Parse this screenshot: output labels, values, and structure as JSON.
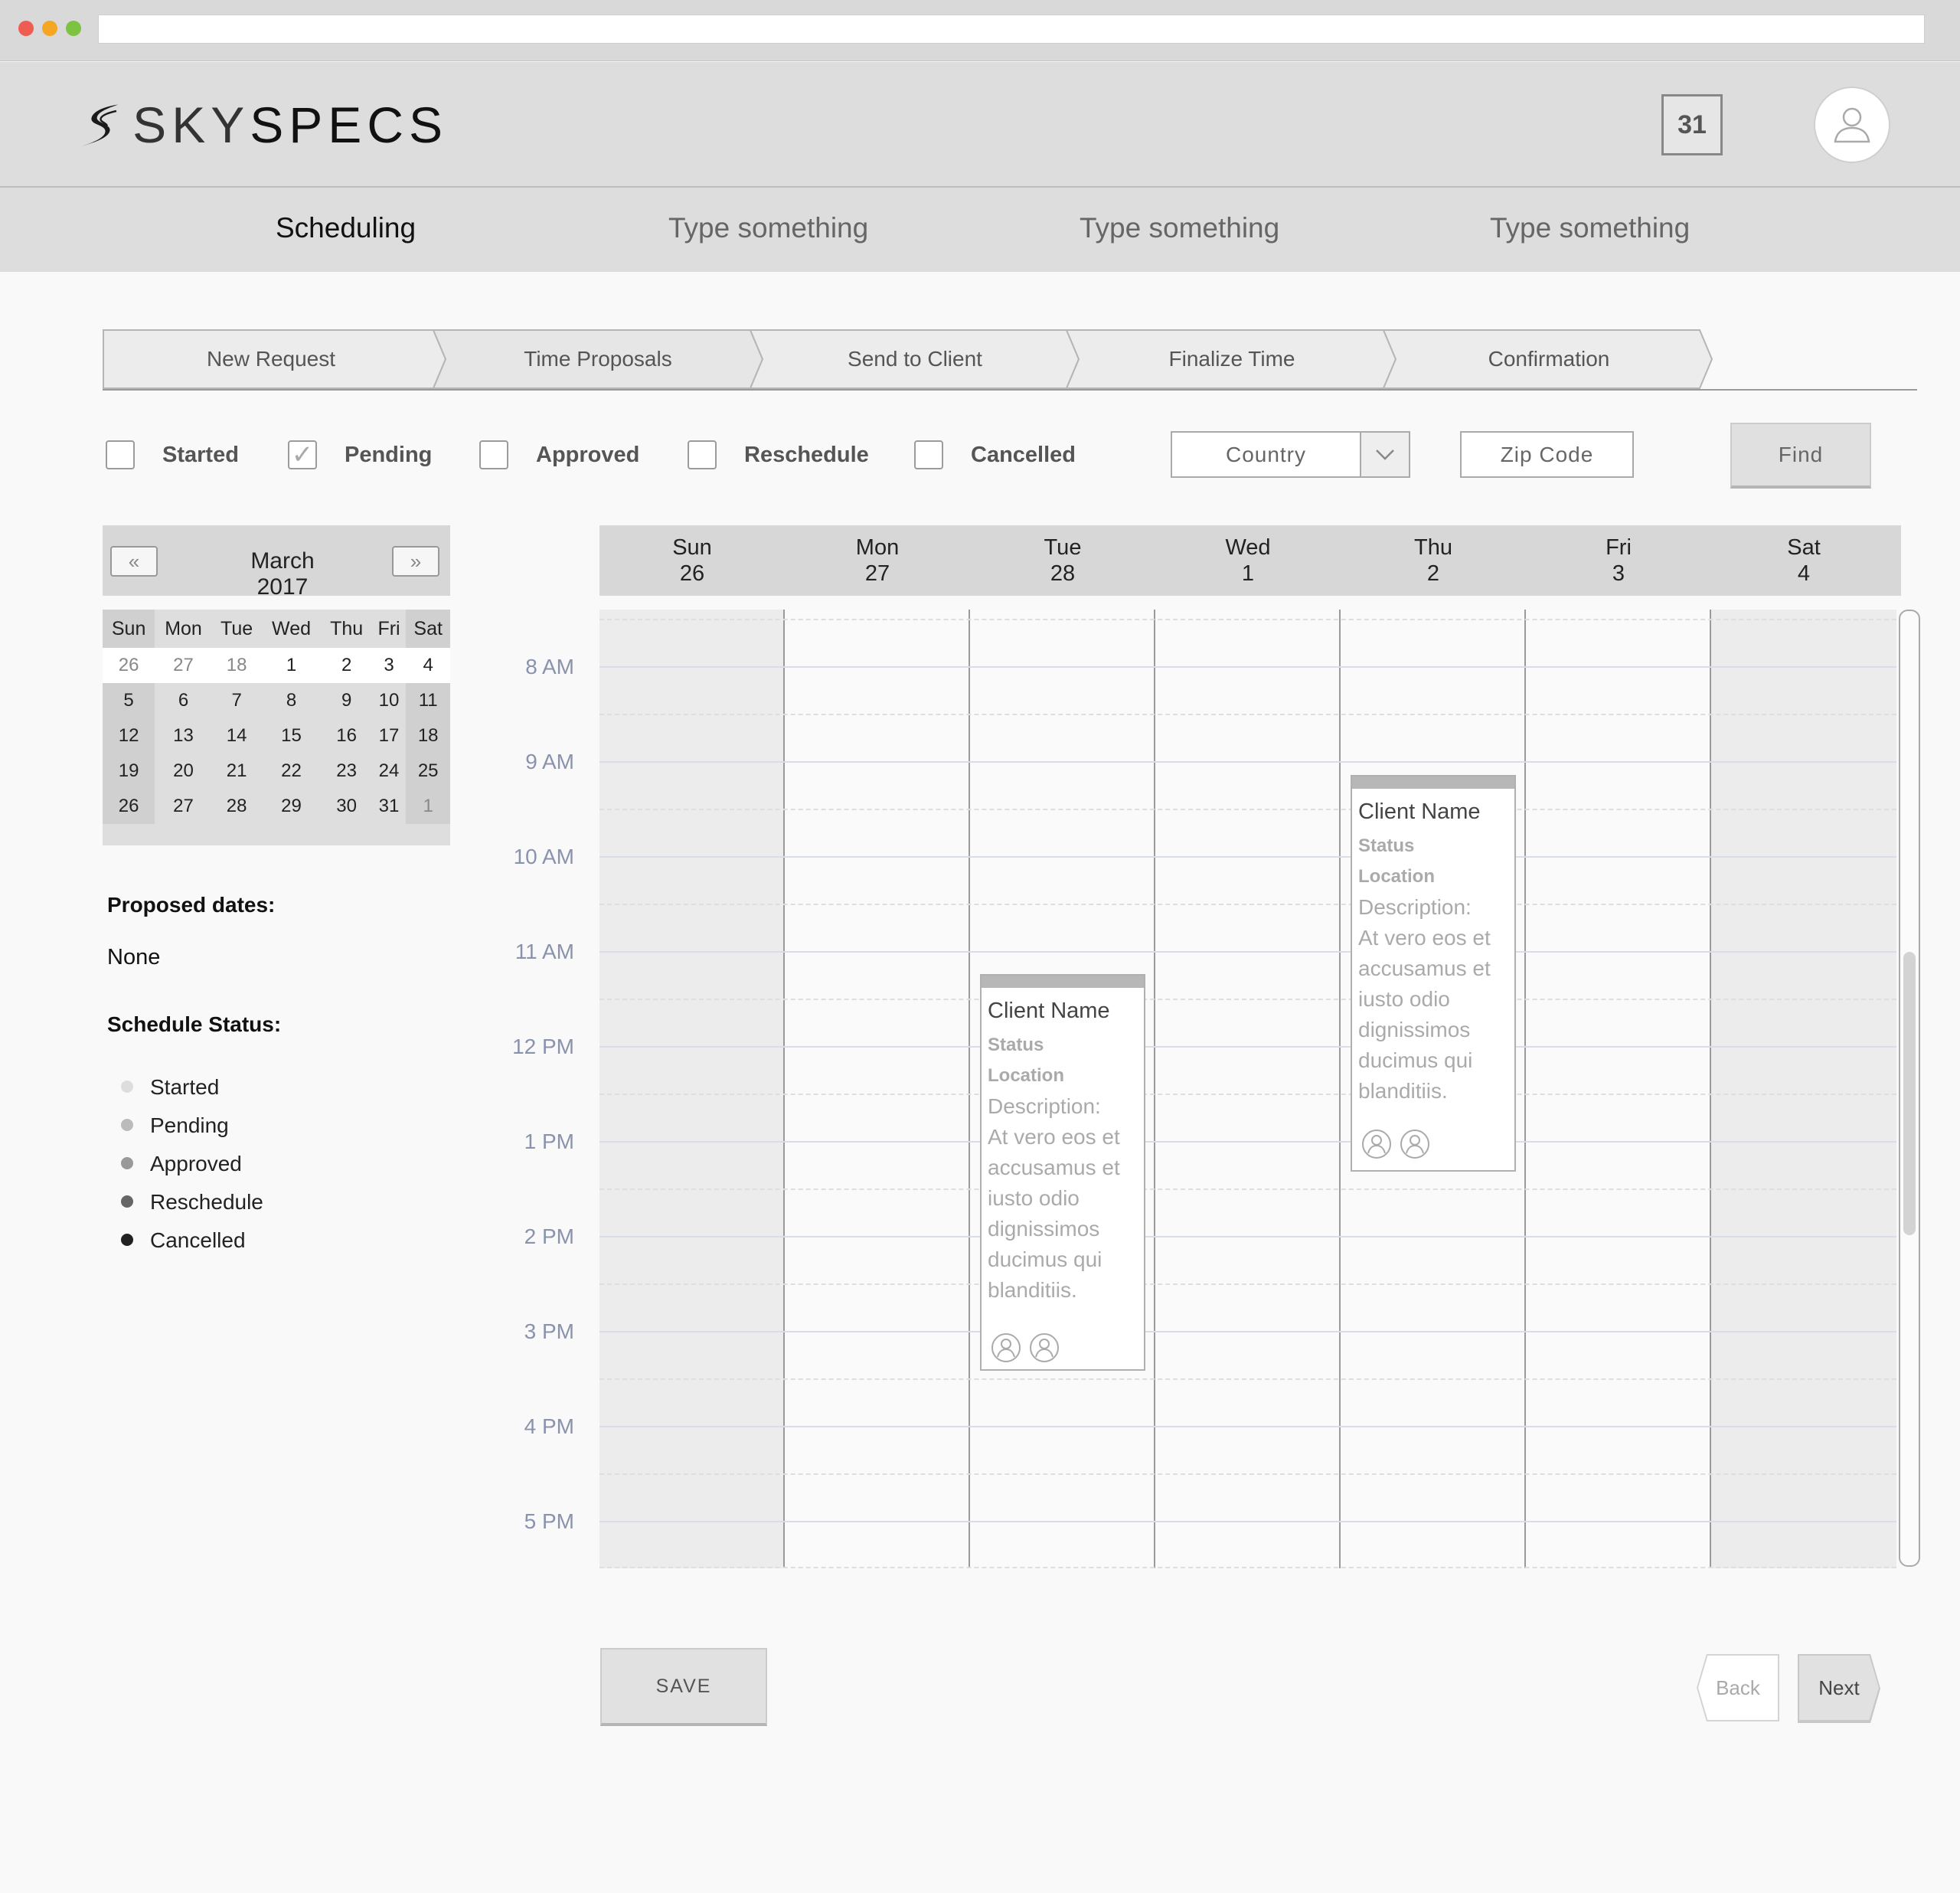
{
  "brand": {
    "name_light": "SKY",
    "name_bold": "SPECS"
  },
  "header": {
    "calendar_day": "31"
  },
  "nav": {
    "tabs": [
      "Scheduling",
      "Type something",
      "Type something",
      "Type something"
    ]
  },
  "steps": [
    "New Request",
    "Time Proposals",
    "Send to Client",
    "Finalize Time",
    "Confirmation"
  ],
  "filters": {
    "checkboxes": [
      {
        "label": "Started",
        "checked": false
      },
      {
        "label": "Pending",
        "checked": true
      },
      {
        "label": "Approved",
        "checked": false
      },
      {
        "label": "Reschedule",
        "checked": false
      },
      {
        "label": "Cancelled",
        "checked": false
      }
    ],
    "country_placeholder": "Country",
    "zip_placeholder": "Zip Code",
    "find_label": "Find"
  },
  "mini_calendar": {
    "prev_icon": "double-chevron-left-icon",
    "next_icon": "double-chevron-right-icon",
    "title": "March 2017",
    "weekdays": [
      "Sun",
      "Mon",
      "Tue",
      "Wed",
      "Thu",
      "Fri",
      "Sat"
    ],
    "weeks": [
      [
        "26",
        "27",
        "18",
        "1",
        "2",
        "3",
        "4"
      ],
      [
        "5",
        "6",
        "7",
        "8",
        "9",
        "10",
        "11"
      ],
      [
        "12",
        "13",
        "14",
        "15",
        "16",
        "17",
        "18"
      ],
      [
        "19",
        "20",
        "21",
        "22",
        "23",
        "24",
        "25"
      ],
      [
        "26",
        "27",
        "28",
        "29",
        "30",
        "31",
        "1"
      ]
    ]
  },
  "proposed": {
    "heading": "Proposed dates:",
    "value": "None"
  },
  "status_legend": {
    "heading": "Schedule Status:",
    "items": [
      {
        "label": "Started",
        "color": "#dddddd"
      },
      {
        "label": "Pending",
        "color": "#bbbbbb"
      },
      {
        "label": "Approved",
        "color": "#999999"
      },
      {
        "label": "Reschedule",
        "color": "#666666"
      },
      {
        "label": "Cancelled",
        "color": "#222222"
      }
    ]
  },
  "week": {
    "days": [
      {
        "name": "Sun",
        "date": "26"
      },
      {
        "name": "Mon",
        "date": "27"
      },
      {
        "name": "Tue",
        "date": "28"
      },
      {
        "name": "Wed",
        "date": "1"
      },
      {
        "name": "Thu",
        "date": "2"
      },
      {
        "name": "Fri",
        "date": "3"
      },
      {
        "name": "Sat",
        "date": "4"
      }
    ],
    "hours": [
      "8 AM",
      "9 AM",
      "10 AM",
      "11 AM",
      "12 PM",
      "1 PM",
      "2 PM",
      "3 PM",
      "4 PM",
      "5 PM"
    ]
  },
  "events": [
    {
      "day": "Tue 28",
      "client": "Client Name",
      "status": "Status",
      "location": "Location",
      "description_label": "Description:",
      "description": "At vero eos et accusamus et iusto odio dignissimos ducimus qui blanditiis."
    },
    {
      "day": "Thu 2",
      "client": "Client Name",
      "status": "Status",
      "location": "Location",
      "description_label": "Description:",
      "description": "At vero eos et accusamus et iusto odio dignissimos ducimus qui blanditiis."
    }
  ],
  "actions": {
    "save": "SAVE",
    "back": "Back",
    "next": "Next"
  }
}
